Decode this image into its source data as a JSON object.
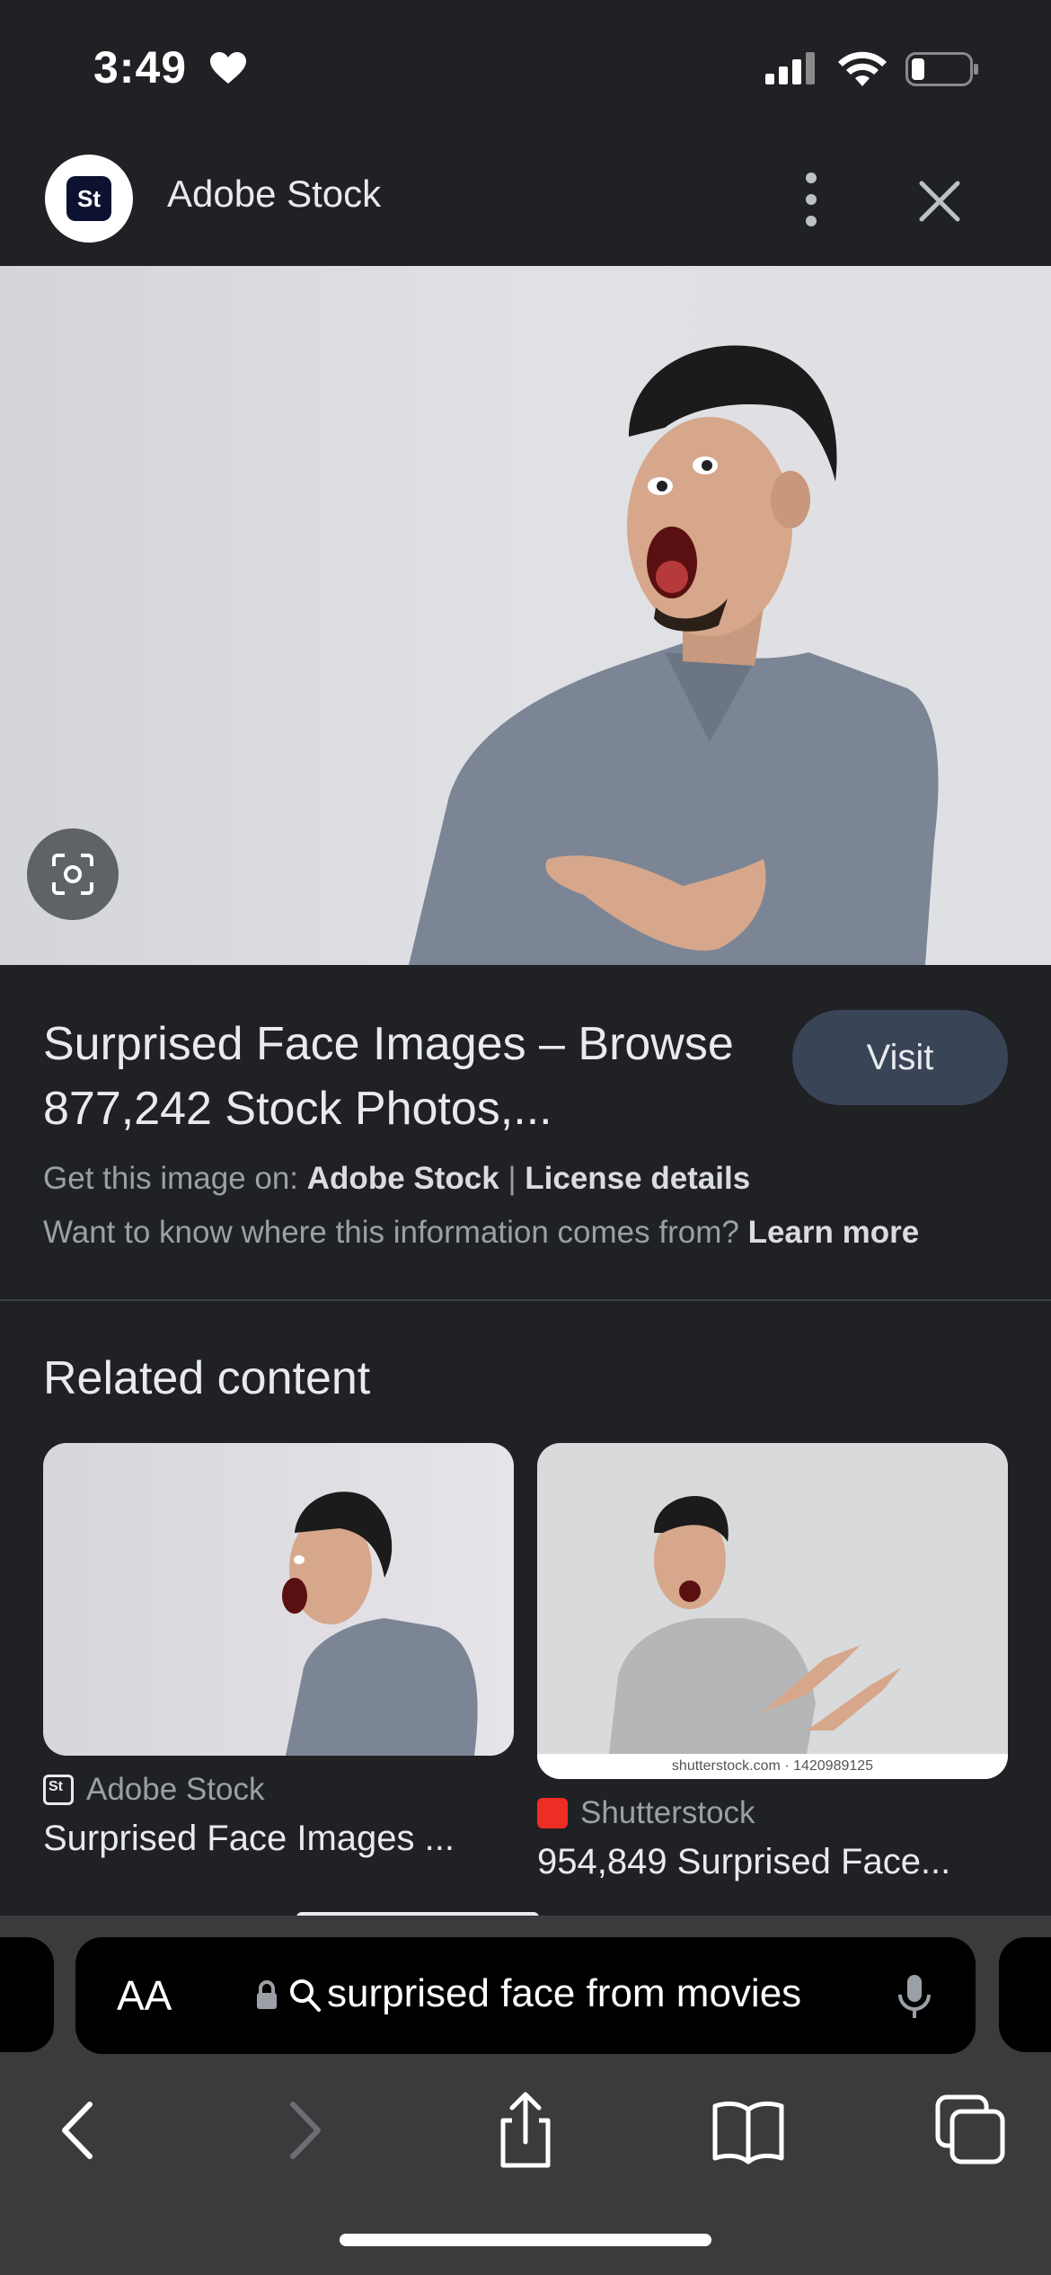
{
  "status_bar": {
    "time": "3:49"
  },
  "source_header": {
    "logo_text": "St",
    "name": "Adobe Stock"
  },
  "result": {
    "title": "Surprised Face Images – Browse 877,242 Stock Photos,...",
    "visit_label": "Visit",
    "get_prefix": "Get this image on:",
    "get_source": "Adobe Stock",
    "separator": "|",
    "license_label": "License details",
    "info_question": "Want to know where this information comes from?",
    "learn_more": "Learn more"
  },
  "related": {
    "title": "Related content",
    "cards": [
      {
        "source": "Adobe Stock",
        "title": "Surprised Face Images ..."
      },
      {
        "source": "Shutterstock",
        "title": "954,849 Surprised Face...",
        "watermark": "shutterstock.com · 1420989125"
      }
    ]
  },
  "safari": {
    "aa_label": "AA",
    "address_text": "surprised face from movies"
  },
  "colors": {
    "background": "#202124",
    "visit_button": "#394457",
    "toolbar": "#3a3b3d"
  }
}
